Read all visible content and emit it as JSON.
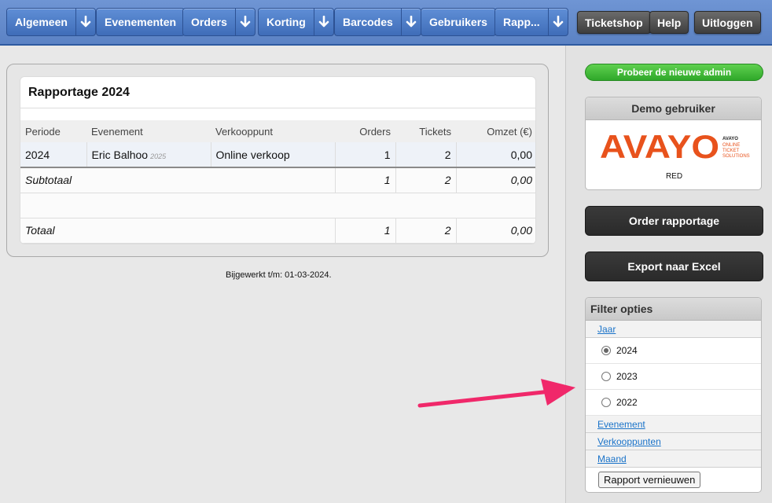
{
  "nav": {
    "algemeen": "Algemeen",
    "evenementen": "Evenementen",
    "orders": "Orders",
    "korting": "Korting",
    "barcodes": "Barcodes",
    "gebruikers": "Gebruikers",
    "rapportage": "Rapp...",
    "ticketshop": "Ticketshop",
    "help": "Help",
    "uitloggen": "Uitloggen"
  },
  "report": {
    "title": "Rapportage 2024",
    "columns": [
      "Periode",
      "Evenement",
      "Verkooppunt",
      "Orders",
      "Tickets",
      "Omzet (€)"
    ],
    "row": {
      "periode": "2024",
      "evenement": "Eric Balhoo",
      "evenement_year": "2025",
      "verkooppunt": "Online verkoop",
      "orders": "1",
      "tickets": "2",
      "omzet": "0,00"
    },
    "subtotal": {
      "label": "Subtotaal",
      "orders": "1",
      "tickets": "2",
      "omzet": "0,00"
    },
    "total": {
      "label": "Totaal",
      "orders": "1",
      "tickets": "2",
      "omzet": "0,00"
    },
    "updated": "Bijgewerkt t/m: 01-03-2024."
  },
  "sidebar": {
    "new_admin": "Probeer de nieuwe admin",
    "demo_title": "Demo gebruiker",
    "logo_text": "AVAYO",
    "logo_sub1": "AVAYO",
    "logo_sub2": "ONLINE",
    "logo_sub3": "TICKET",
    "logo_sub4": "SOLUTIONS",
    "demo_caption": "RED",
    "order_report": "Order rapportage",
    "export_excel": "Export naar Excel",
    "filter": {
      "title": "Filter opties",
      "jaar": "Jaar",
      "years": [
        "2024",
        "2023",
        "2022"
      ],
      "selected_year": "2024",
      "evenement": "Evenement",
      "verkooppunten": "Verkooppunten",
      "maand": "Maand",
      "refresh": "Rapport vernieuwen"
    }
  },
  "colors": {
    "nav_blue": "#4f7fc8",
    "accent_green": "#3cb035",
    "logo_orange": "#e8521c",
    "annotation_arrow": "#f0286a",
    "link_blue": "#1a73c9"
  }
}
